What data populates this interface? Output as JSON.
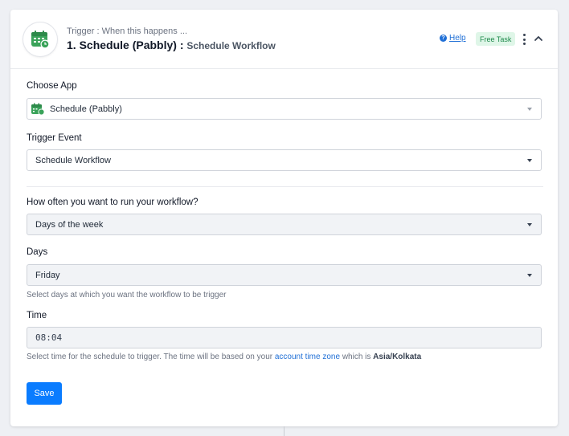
{
  "step": {
    "subtitle": "Trigger : When this happens ...",
    "title_prefix": "1. Schedule (Pabbly) : ",
    "title_event": "Schedule Workflow",
    "help_label": "Help",
    "badge": "Free Task",
    "app_icon": "calendar-clock-icon"
  },
  "form": {
    "choose_app_label": "Choose App",
    "choose_app_value": "Schedule (Pabbly)",
    "trigger_event_label": "Trigger Event",
    "trigger_event_value": "Schedule Workflow",
    "frequency_label": "How often you want to run your workflow?",
    "frequency_value": "Days of the week",
    "days_label": "Days",
    "days_value": "Friday",
    "days_hint": "Select days at which you want the workflow to be trigger",
    "time_label": "Time",
    "time_value": "08:04",
    "time_hint_prefix": "Select time for the schedule to trigger. The time will be based on your ",
    "time_hint_link": "account time zone",
    "time_hint_middle": " which is ",
    "time_hint_zone": "Asia/Kolkata",
    "save_label": "Save"
  },
  "colors": {
    "accent": "#0a7cff",
    "app_green": "#3aa35a",
    "badge_bg": "#dff6e8",
    "badge_text": "#1f8a4c"
  }
}
